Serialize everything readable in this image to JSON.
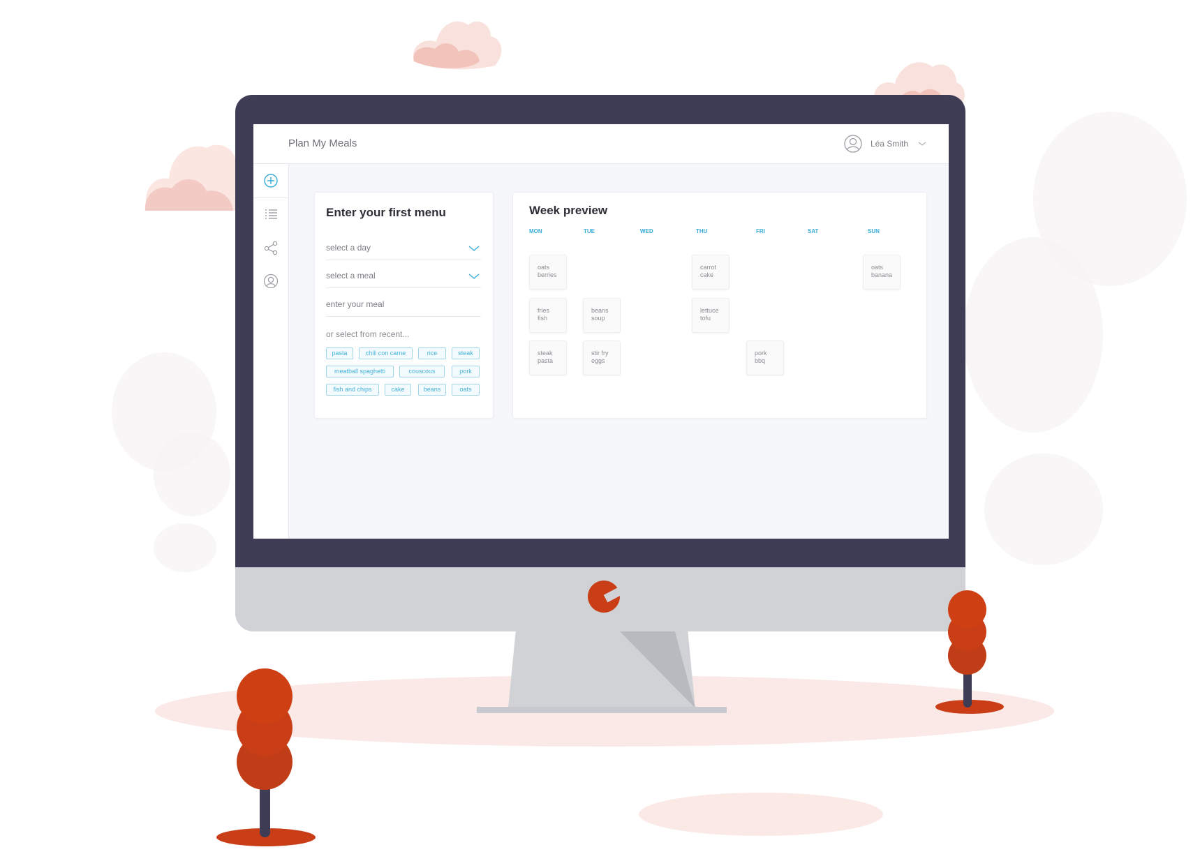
{
  "app": {
    "title": "Plan My Meals",
    "user_name": "Léa Smith"
  },
  "sidebar": {
    "items": [
      {
        "name": "add",
        "icon": "plus-circle-icon",
        "active": true
      },
      {
        "name": "list",
        "icon": "list-icon",
        "active": false
      },
      {
        "name": "share",
        "icon": "share-icon",
        "active": false
      },
      {
        "name": "profile",
        "icon": "user-circle-icon",
        "active": false
      }
    ]
  },
  "menu_form": {
    "title": "Enter your first menu",
    "day_select": "select a day",
    "meal_select": "select a meal",
    "meal_input_placeholder": "enter your meal",
    "recent_label": "or select from recent...",
    "recent_tags": [
      "pasta",
      "chili con carne",
      "rice",
      "steak",
      "meatball spaghetti",
      "couscous",
      "pork",
      "fish and chips",
      "cake",
      "beans",
      "oats"
    ]
  },
  "week_preview": {
    "title": "Week preview",
    "days": [
      "MON",
      "TUE",
      "WED",
      "THU",
      "FRI",
      "SAT",
      "SUN"
    ],
    "meals": [
      {
        "day": "MON",
        "slot": 1,
        "line1": "oats",
        "line2": "berries"
      },
      {
        "day": "THU",
        "slot": 1,
        "line1": "carrot",
        "line2": "cake"
      },
      {
        "day": "SUN",
        "slot": 1,
        "line1": "oats",
        "line2": "banana"
      },
      {
        "day": "MON",
        "slot": 2,
        "line1": "fries",
        "line2": "fish"
      },
      {
        "day": "TUE",
        "slot": 2,
        "line1": "beans",
        "line2": "soup"
      },
      {
        "day": "THU",
        "slot": 2,
        "line1": "lettuce",
        "line2": "tofu"
      },
      {
        "day": "MON",
        "slot": 3,
        "line1": "steak",
        "line2": "pasta"
      },
      {
        "day": "TUE",
        "slot": 3,
        "line1": "stir fry",
        "line2": "eggs"
      },
      {
        "day": "FRI",
        "slot": 3,
        "line1": "pork",
        "line2": "bbq"
      }
    ]
  },
  "colors": {
    "accent": "#35abd7",
    "bezel": "#3f3d56",
    "tree": "#c93e16",
    "cloud": "#f4c9c2"
  }
}
